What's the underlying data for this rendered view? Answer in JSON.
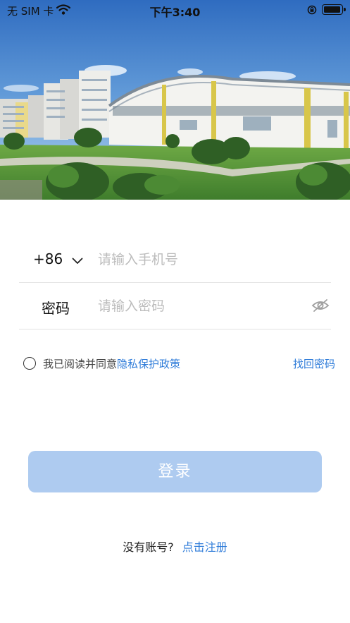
{
  "status_bar": {
    "carrier": "无 SIM 卡",
    "time": "下午3:40",
    "wifi_icon": "wifi-icon",
    "rotation_lock_icon": "rotation-lock-icon",
    "battery_icon": "battery-icon"
  },
  "hero": {
    "image": "campus-buildings-photo"
  },
  "login_form": {
    "country_code": "+86",
    "phone_placeholder": "请输入手机号",
    "phone_value": "",
    "password_label": "密码",
    "password_placeholder": "请输入密码",
    "password_value": "",
    "eye_icon": "eye-hidden-icon"
  },
  "agreement": {
    "prefix": "我已阅读并同意",
    "policy_link": "隐私保护政策",
    "checked": false
  },
  "forgot_password": "找回密码",
  "login_button": "登录",
  "register": {
    "prompt": "没有账号?",
    "link": "点击注册"
  },
  "colors": {
    "accent": "#2f7cd9",
    "button_disabled": "#aecbf0",
    "placeholder": "#bcbcbc",
    "divider": "#e3e3e3"
  }
}
